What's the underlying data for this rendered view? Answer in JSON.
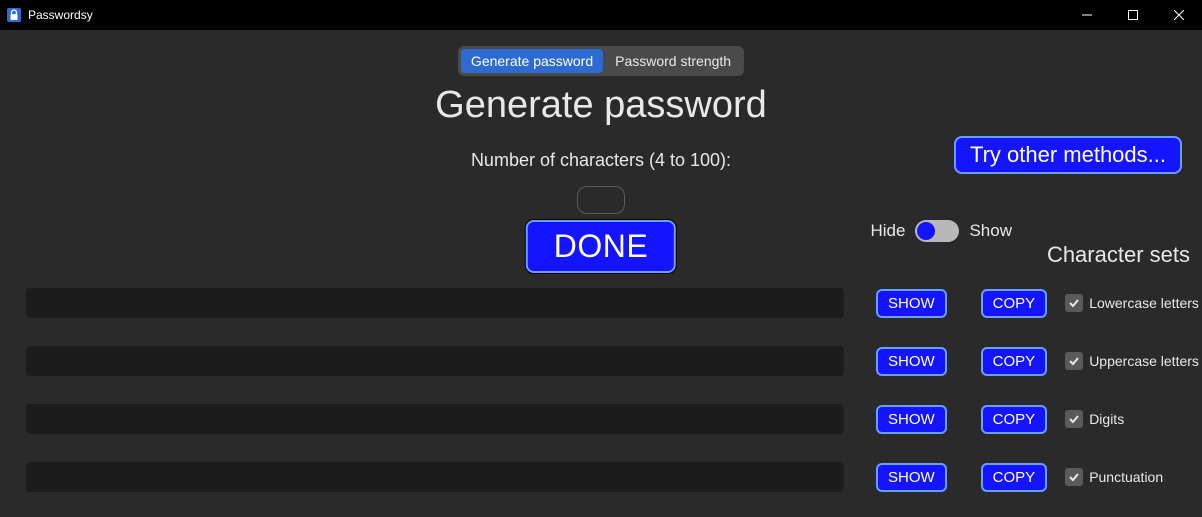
{
  "window": {
    "title": "Passwordsy"
  },
  "tabs": {
    "generate": "Generate password",
    "strength": "Password strength"
  },
  "heading": "Generate password",
  "subtitle": "Number of characters (4 to 100):",
  "count_value": "",
  "done_label": "DONE",
  "other_methods_label": "Try other methods...",
  "toggle": {
    "hide": "Hide",
    "show": "Show"
  },
  "charset_heading": "Character sets",
  "buttons": {
    "show": "SHOW",
    "copy": "COPY"
  },
  "rows": [
    {
      "value": "",
      "charset_label": "Lowercase letters"
    },
    {
      "value": "",
      "charset_label": "Uppercase letters"
    },
    {
      "value": "",
      "charset_label": "Digits"
    },
    {
      "value": "",
      "charset_label": "Punctuation"
    }
  ],
  "colors": {
    "accent": "#1414ff",
    "accent_border": "#6a9eff",
    "bg": "#2a2a2a",
    "field_bg": "#1d1c1c",
    "tab_active": "#2d6bd1"
  }
}
